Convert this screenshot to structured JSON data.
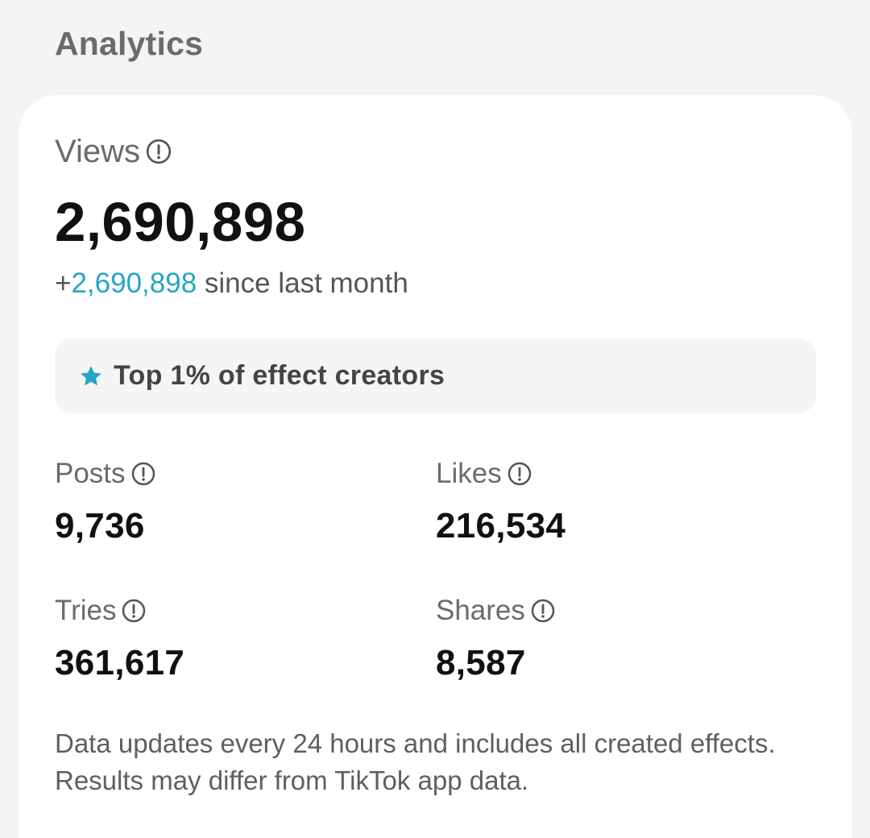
{
  "section": {
    "title": "Analytics"
  },
  "views": {
    "label": "Views",
    "value": "2,690,898",
    "change_prefix": "+",
    "change_value": "2,690,898",
    "change_suffix": " since last month"
  },
  "badge": {
    "icon": "star-icon",
    "text": "Top 1% of effect creators"
  },
  "metrics": {
    "posts": {
      "label": "Posts",
      "value": "9,736"
    },
    "likes": {
      "label": "Likes",
      "value": "216,534"
    },
    "tries": {
      "label": "Tries",
      "value": "361,617"
    },
    "shares": {
      "label": "Shares",
      "value": "8,587"
    }
  },
  "footnote": {
    "text": "Data updates every 24 hours and includes all created effects. Results may differ from TikTok app data."
  },
  "colors": {
    "accent": "#25a6c4",
    "page_background": "#f4f4f4",
    "card_background": "#ffffff",
    "badge_background": "#f5f5f5"
  },
  "icons": {
    "info": "info-icon",
    "star": "star-icon"
  }
}
